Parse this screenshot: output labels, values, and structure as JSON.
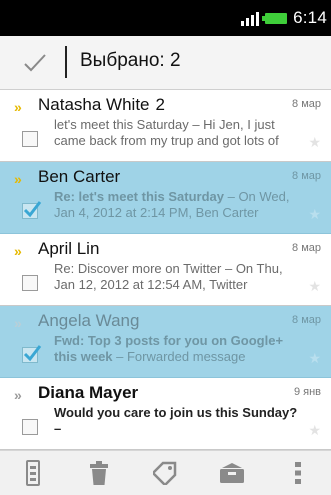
{
  "status_bar": {
    "time": "6:14",
    "icons": [
      "signal-icon",
      "battery-icon"
    ]
  },
  "action_bar": {
    "title": "Выбрано: 2",
    "done_icon": "checkmark-icon"
  },
  "messages": [
    {
      "sender": "Natasha White",
      "count": "2",
      "date": "8 мар",
      "selected": false,
      "marker": "priority-marker",
      "snippet_parts": [
        "let's meet this Saturday – Hi Jen, I just came back from my trup and got lots of"
      ]
    },
    {
      "sender": "Ben Carter",
      "count": "",
      "date": "8 мар",
      "selected": true,
      "marker": "priority-marker",
      "subject": "Re: let's meet this Saturday",
      "snippet": " – On Wed, Jan 4, 2012 at 2:14 PM, Ben Carter"
    },
    {
      "sender": "April Lin",
      "count": "",
      "date": "8 мар",
      "selected": false,
      "marker": "priority-marker",
      "snippet": "Re: Discover more on Twitter – On Thu, Jan 12, 2012 at 12:54 AM, Twitter"
    },
    {
      "sender": "Angela Wang",
      "count": "",
      "date": "8 мар",
      "selected": true,
      "marker": "priority-marker",
      "subject": "Fwd: Top 3 posts for you on Google+ this week",
      "snippet": " – Forwarded message"
    },
    {
      "sender": "Diana Mayer",
      "count": "",
      "date": "9 янв",
      "selected": false,
      "marker": "normal-marker",
      "subject": "Would you care to join us this Sunday? –"
    }
  ],
  "toolbar": {
    "icons": [
      "labels-icon",
      "trash-icon",
      "tag-icon",
      "archive-icon",
      "overflow-menu-icon"
    ]
  },
  "colors": {
    "selected_row": "#9fd3e7",
    "priority_marker": "#e6b900",
    "battery": "#3fce3a"
  }
}
